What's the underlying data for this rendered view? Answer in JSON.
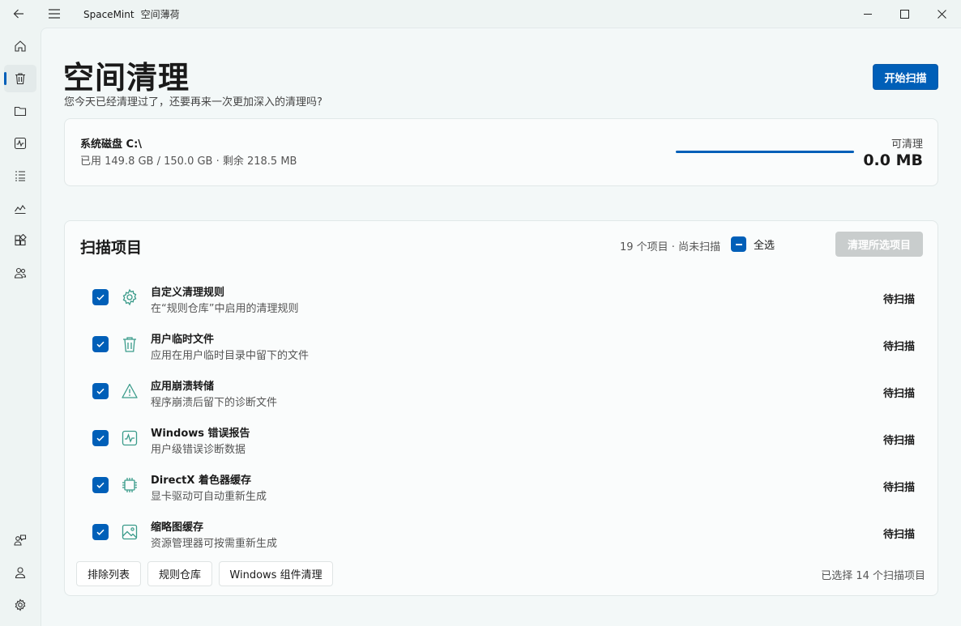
{
  "app": {
    "name": "SpaceMint",
    "subtitle": "空间薄荷"
  },
  "page": {
    "title": "空间清理",
    "subtitle": "您今天已经清理过了，还要再来一次更加深入的清理吗?",
    "start_scan_label": "开始扫描"
  },
  "disk": {
    "title": "系统磁盘 C:\\",
    "detail": "已用 149.8 GB / 150.0 GB · 剩余 218.5 MB",
    "cleanable_label": "可清理",
    "cleanable_value": "0.0 MB",
    "used_fraction": 0.9986
  },
  "scan": {
    "title": "扫描项目",
    "count_text": "19 个项目 · 尚未扫描",
    "select_all_label": "全选",
    "clean_selected_label": "清理所选项目",
    "items": [
      {
        "name": "自定义清理规则",
        "desc": "在“规则仓库”中启用的清理规则",
        "status": "待扫描",
        "icon": "gear-icon"
      },
      {
        "name": "用户临时文件",
        "desc": "应用在用户临时目录中留下的文件",
        "status": "待扫描",
        "icon": "trash-icon"
      },
      {
        "name": "应用崩溃转储",
        "desc": "程序崩溃后留下的诊断文件",
        "status": "待扫描",
        "icon": "warning-icon"
      },
      {
        "name": "Windows 错误报告",
        "desc": "用户级错误诊断数据",
        "status": "待扫描",
        "icon": "pulse-icon"
      },
      {
        "name": "DirectX 着色器缓存",
        "desc": "显卡驱动可自动重新生成",
        "status": "待扫描",
        "icon": "chip-icon"
      },
      {
        "name": "缩略图缓存",
        "desc": "资源管理器可按需重新生成",
        "status": "待扫描",
        "icon": "image-icon"
      }
    ],
    "footer_buttons": {
      "exclusions": "排除列表",
      "rules": "规则仓库",
      "components": "Windows 组件清理"
    },
    "selected_text": "已选择 14 个扫描项目"
  },
  "colors": {
    "accent": "#005fb8",
    "icon_green": "#3a9b8a"
  }
}
